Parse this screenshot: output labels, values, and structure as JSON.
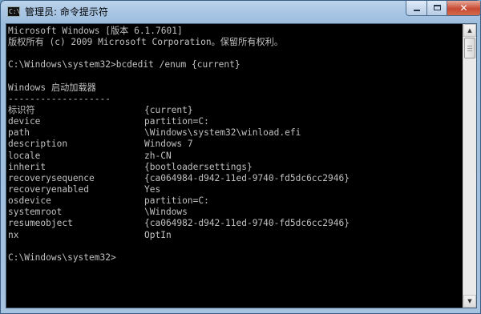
{
  "window": {
    "title": "管理员: 命令提示符",
    "icon_text": "C:\\"
  },
  "console": {
    "banner": [
      "Microsoft Windows [版本 6.1.7601]",
      "版权所有 (c) 2009 Microsoft Corporation。保留所有权利。"
    ],
    "prompt_command": "C:\\Windows\\system32>bcdedit /enum {current}",
    "section_title": "Windows 启动加载器",
    "section_rule": "-------------------",
    "entries": [
      {
        "key": "标识符",
        "value": "{current}"
      },
      {
        "key": "device",
        "value": "partition=C:"
      },
      {
        "key": "path",
        "value": "\\Windows\\system32\\winload.efi"
      },
      {
        "key": "description",
        "value": "Windows 7"
      },
      {
        "key": "locale",
        "value": "zh-CN"
      },
      {
        "key": "inherit",
        "value": "{bootloadersettings}"
      },
      {
        "key": "recoverysequence",
        "value": "{ca064984-d942-11ed-9740-fd5dc6cc2946}"
      },
      {
        "key": "recoveryenabled",
        "value": "Yes"
      },
      {
        "key": "osdevice",
        "value": "partition=C:"
      },
      {
        "key": "systemroot",
        "value": "\\Windows"
      },
      {
        "key": "resumeobject",
        "value": "{ca064982-d942-11ed-9740-fd5dc6cc2946}"
      },
      {
        "key": "nx",
        "value": "OptIn"
      }
    ],
    "prompt_final": "C:\\Windows\\system32>"
  }
}
